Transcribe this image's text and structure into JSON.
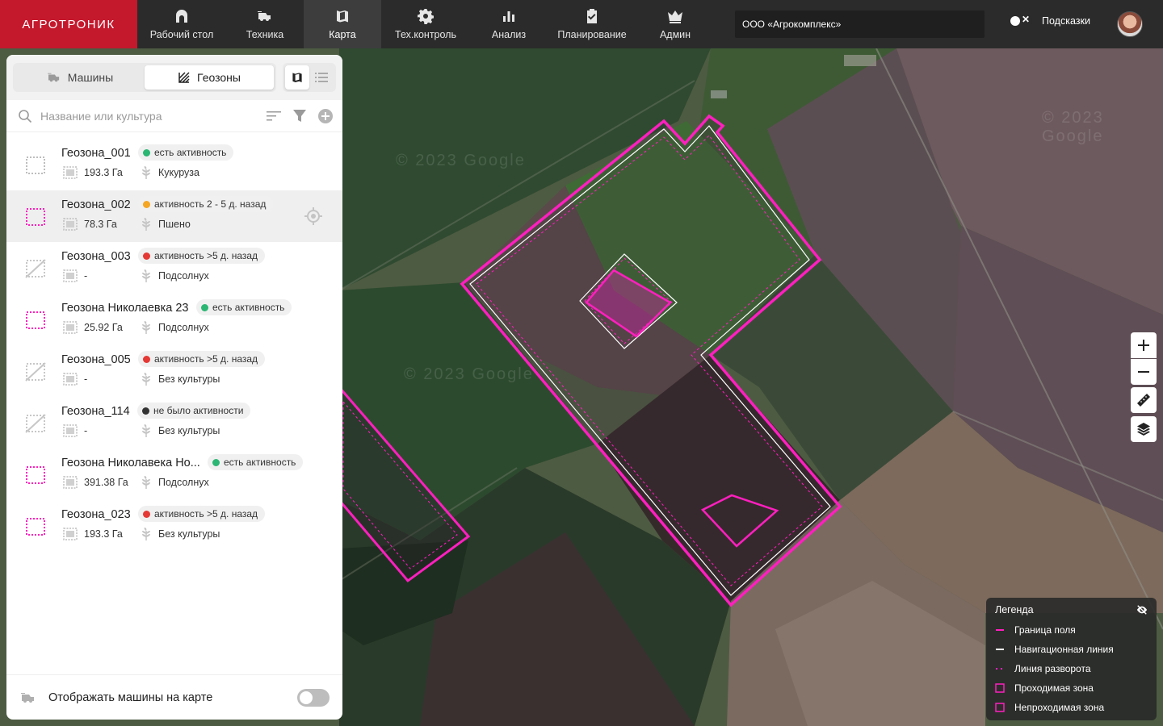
{
  "brand": {
    "logo_text": "АГРОТРОНИК"
  },
  "nav": [
    {
      "label": "Рабочий стол",
      "icon": "home-icon"
    },
    {
      "label": "Техника",
      "icon": "harvester-icon"
    },
    {
      "label": "Карта",
      "icon": "map-icon",
      "active": true
    },
    {
      "label": "Тех.контроль",
      "icon": "gear-icon"
    },
    {
      "label": "Анализ",
      "icon": "bar-chart-icon"
    },
    {
      "label": "Планирование",
      "icon": "clipboard-check-icon"
    },
    {
      "label": "Админ",
      "icon": "crown-icon"
    }
  ],
  "org": {
    "value": "ООО «Агрокомплекс»"
  },
  "hints": {
    "label": "Подсказки",
    "enabled": false
  },
  "panel": {
    "tabs": [
      {
        "label": "Машины",
        "icon": "harvester-icon",
        "active": false
      },
      {
        "label": "Геозоны",
        "icon": "field-icon",
        "active": true
      }
    ],
    "search_placeholder": "Название или культура",
    "items": [
      {
        "name": "Геозона_001",
        "status": "есть активность",
        "status_color": "#2bb673",
        "area": "193.3 Га",
        "crop": "Кукуруза",
        "shape": "dotted-gray"
      },
      {
        "name": "Геозона_002",
        "status": "активность 2 - 5 д. назад",
        "status_color": "#f5a623",
        "area": "78.3 Га",
        "crop": "Пшено",
        "shape": "dotted-magenta",
        "selected": true
      },
      {
        "name": "Геозона_003",
        "status": "активность >5 д. назад",
        "status_color": "#e53935",
        "area": "-",
        "crop": "Подсолнух",
        "shape": "crossed-gray"
      },
      {
        "name": "Геозона Николаевка 23",
        "status": "есть активность",
        "status_color": "#2bb673",
        "area": "25.92 Га",
        "crop": "Подсолнух",
        "shape": "dotted-magenta"
      },
      {
        "name": "Геозона_005",
        "status": "активность >5 д. назад",
        "status_color": "#e53935",
        "area": "-",
        "crop": "Без культуры",
        "shape": "crossed-gray"
      },
      {
        "name": "Геозона_114",
        "status": "не было активности",
        "status_color": "#333333",
        "area": "-",
        "crop": "Без культуры",
        "shape": "crossed-gray"
      },
      {
        "name": "Геозона Николавека Но...",
        "status": "есть активность",
        "status_color": "#2bb673",
        "area": "391.38 Га",
        "crop": "Подсолнух",
        "shape": "dotted-magenta"
      },
      {
        "name": "Геозона_023",
        "status": "активность >5 д. назад",
        "status_color": "#e53935",
        "area": "193.3 Га",
        "crop": "Без культуры",
        "shape": "dotted-magenta"
      }
    ],
    "footer_label": "Отображать машины на карте",
    "footer_toggle": false
  },
  "map": {
    "watermark": "© 2023 Google",
    "legend": {
      "title": "Легенда",
      "items": [
        {
          "label": "Граница поля",
          "type": "solid-line",
          "color": "#ff1fbf"
        },
        {
          "label": "Навигационная линия",
          "type": "solid-line",
          "color": "#ffffff"
        },
        {
          "label": "Линия разворота",
          "type": "dotted-line",
          "color": "#ff1fbf"
        },
        {
          "label": "Проходимая зона",
          "type": "square-outline",
          "color": "#ff1fbf"
        },
        {
          "label": "Непроходимая зона",
          "type": "square-outline",
          "color": "#ff1fbf"
        }
      ]
    }
  }
}
